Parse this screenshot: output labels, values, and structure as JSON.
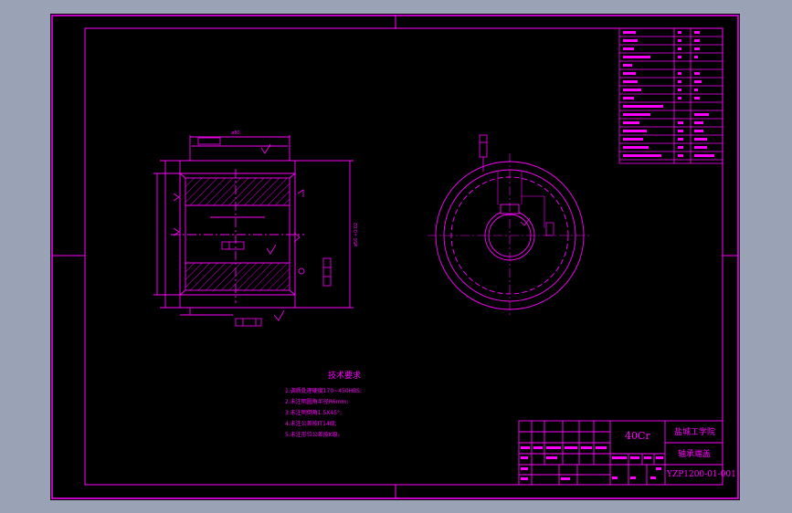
{
  "drawing": {
    "material": "40Cr",
    "school": "盐城工学院",
    "part_name": "轴承端盖",
    "drawing_no": "YZP1200-01-001",
    "dim_top": "ø80",
    "dim_right": "ø56 +0.02"
  },
  "tech_requirements": {
    "title": "技术要求",
    "items": [
      "1.调质处理硬度170~450HBS;",
      "2.未注明圆角半径R6mm;",
      "3.未注明倒角1.5X45°;",
      "4.未注公差按IT14级;",
      "5.未注形位公差按K级。"
    ]
  },
  "colors": {
    "line": "#ff00ff",
    "bg": "#000000",
    "frame_bg": "#9aa3b5"
  }
}
